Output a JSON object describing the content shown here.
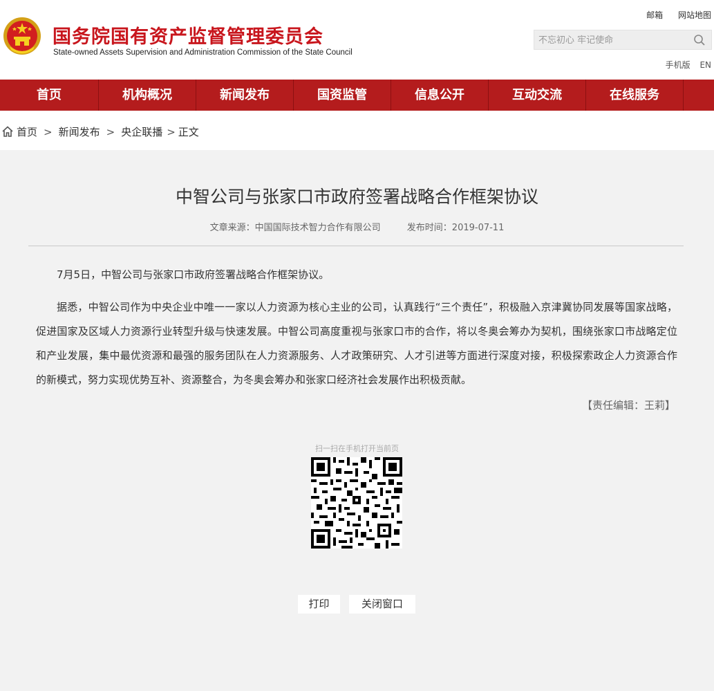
{
  "header": {
    "site_title": "国务院国有资产监督管理委员会",
    "site_subtitle": "State-owned Assets Supervision and Administration Commission of the State Council",
    "toplinks": {
      "mail": "邮箱",
      "map": "网站地图"
    },
    "search": {
      "placeholder": "不忘初心 牢记使命"
    },
    "sublinks": {
      "mobile": "手机版",
      "en": "EN"
    },
    "brand_color": "#b41c1d",
    "emblem_icon": "national-emblem-icon"
  },
  "nav": {
    "items": [
      "首页",
      "机构概况",
      "新闻发布",
      "国资监管",
      "信息公开",
      "互动交流",
      "在线服务"
    ]
  },
  "breadcrumb": {
    "home": "首页",
    "level1": "新闻发布",
    "level2": "央企联播",
    "current": "正文",
    "separator": ">",
    "home_icon": "home-icon"
  },
  "article": {
    "title": "中智公司与张家口市政府签署战略合作框架协议",
    "source": "文章来源：中国国际技术智力合作有限公司",
    "publish_time": "发布时间：2019-07-11",
    "paragraphs": [
      "7月5日，中智公司与张家口市政府签署战略合作框架协议。",
      "据悉，中智公司作为中央企业中唯一一家以人力资源为核心主业的公司，认真践行“三个责任”，积极融入京津冀协同发展等国家战略，促进国家及区域人力资源行业转型升级与快速发展。中智公司高度重视与张家口市的合作，将以冬奥会筹办为契机，围绕张家口市战略定位和产业发展，集中最优资源和最强的服务团队在人力资源服务、人才政策研究、人才引进等方面进行深度对接，积极探索政企人力资源合作的新模式，努力实现优势互补、资源整合，为冬奥会筹办和张家口经济社会发展作出积极贡献。"
    ],
    "editor": "【责任编辑：王莉】"
  },
  "qr": {
    "caption": "扫一扫在手机打开当前页"
  },
  "actions": {
    "print": "打印",
    "close": "关闭窗口"
  }
}
